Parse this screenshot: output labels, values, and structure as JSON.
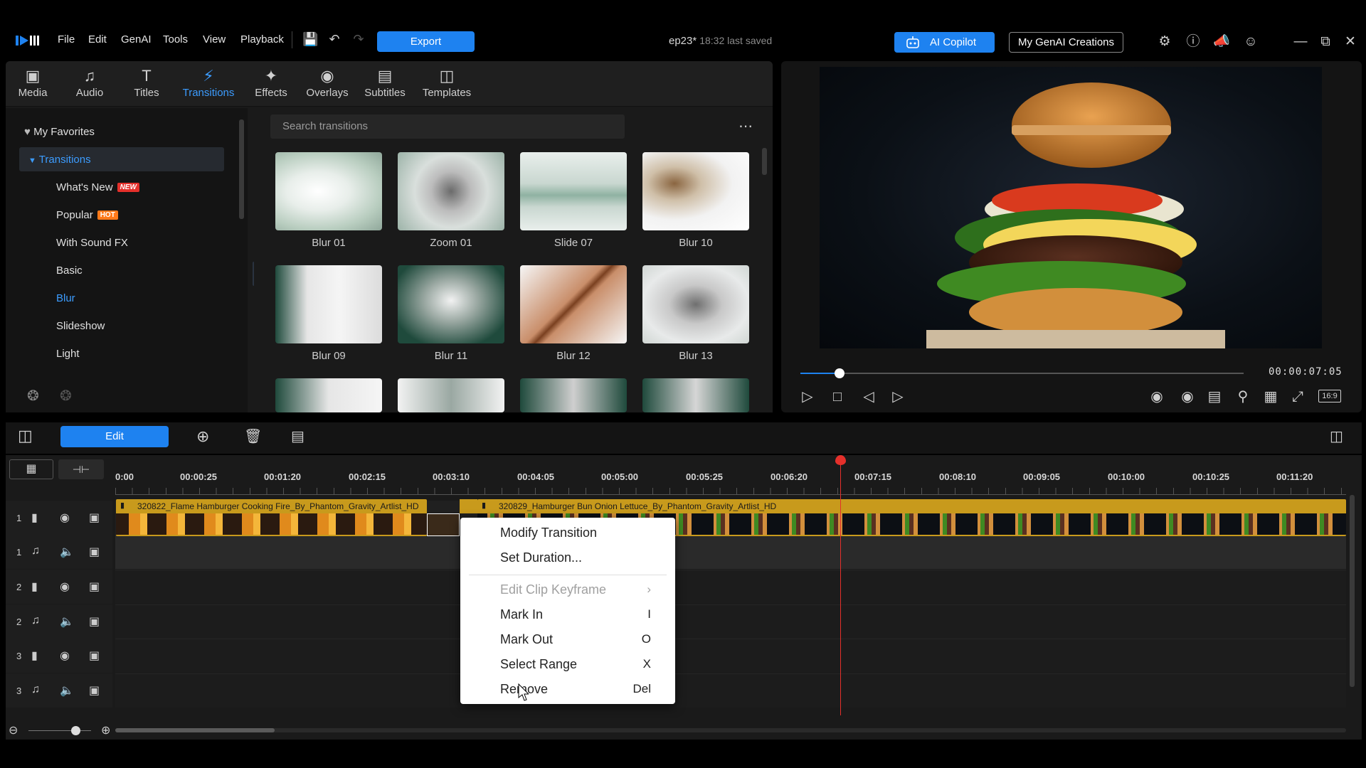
{
  "menu": [
    "File",
    "Edit",
    "GenAI",
    "Tools",
    "View",
    "Playback"
  ],
  "toolbar": {
    "export_label": "Export"
  },
  "project": {
    "name": "ep23*",
    "saved": "18:32 last saved"
  },
  "header_right": {
    "copilot_label": "AI Copilot",
    "genai_label": "My GenAI Creations"
  },
  "category_tabs": [
    {
      "label": "Media",
      "icon": "media-icon"
    },
    {
      "label": "Audio",
      "icon": "music-note-icon"
    },
    {
      "label": "Titles",
      "icon": "title-t-icon"
    },
    {
      "label": "Transitions",
      "icon": "transition-icon",
      "active": true
    },
    {
      "label": "Effects",
      "icon": "effects-icon"
    },
    {
      "label": "Overlays",
      "icon": "overlay-icon"
    },
    {
      "label": "Subtitles",
      "icon": "subtitles-icon"
    },
    {
      "label": "Templates",
      "icon": "templates-icon"
    }
  ],
  "tree": {
    "favorites": "My Favorites",
    "transitions": "Transitions",
    "items": [
      "What's New",
      "Popular",
      "With Sound FX",
      "Basic",
      "Blur",
      "Slideshow",
      "Light"
    ],
    "new_tag": "NEW",
    "hot_tag": "HOT",
    "selected": "Blur"
  },
  "search": {
    "placeholder": "Search transitions"
  },
  "thumbnails": [
    "Blur 01",
    "Zoom 01",
    "Slide 07",
    "Blur 10",
    "Blur 09",
    "Blur 11",
    "Blur 12",
    "Blur 13"
  ],
  "preview": {
    "timecode": "00:00:07:05",
    "aspect": "16:9",
    "progress": 0.09
  },
  "timeline_toolbar": {
    "edit_label": "Edit"
  },
  "ruler": [
    "0:00",
    "00:00:25",
    "00:01:20",
    "00:02:15",
    "00:03:10",
    "00:04:05",
    "00:05:00",
    "00:05:25",
    "00:06:20",
    "00:07:15",
    "00:08:10",
    "00:09:05",
    "00:10:00",
    "00:10:25",
    "00:11:20"
  ],
  "tracks": [
    {
      "num": "1",
      "type": "video"
    },
    {
      "num": "1",
      "type": "audio"
    },
    {
      "num": "2",
      "type": "video"
    },
    {
      "num": "2",
      "type": "audio"
    },
    {
      "num": "3",
      "type": "video"
    },
    {
      "num": "3",
      "type": "audio"
    }
  ],
  "clips": [
    {
      "label": "320822_Flame Hamburger Cooking Fire_By_Phantom_Gravity_Artlist_HD"
    },
    {
      "label": "320829_Hamburger Bun Onion Lettuce_By_Phantom_Gravity_Artlist_HD"
    }
  ],
  "context_menu": [
    {
      "label": "Modify Transition",
      "key": ""
    },
    {
      "label": "Set Duration...",
      "key": ""
    },
    {
      "label": "Edit Clip Keyframe",
      "key": "",
      "disabled": true,
      "submenu": true
    },
    {
      "label": "Mark In",
      "key": "I"
    },
    {
      "label": "Mark Out",
      "key": "O"
    },
    {
      "label": "Select Range",
      "key": "X"
    },
    {
      "label": "Remove",
      "key": "Del"
    }
  ],
  "colors": {
    "accent": "#1e82f0",
    "clip": "#c89a1c",
    "playhead": "#e5302b",
    "selected": "#3c9cff"
  }
}
